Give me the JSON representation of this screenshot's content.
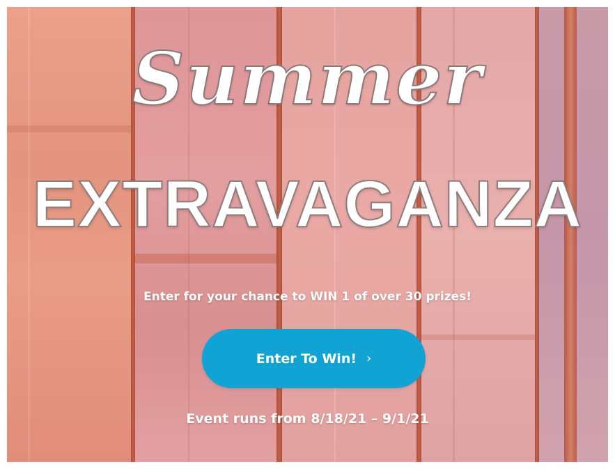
{
  "hero": {
    "script_title": "Summer",
    "main_title": "EXTRAVAGANZA",
    "tagline": "Enter for your chance to WIN 1 of over 30 prizes!",
    "cta": {
      "label": "Enter To Win!",
      "icon": "chevron-right-icon",
      "glyph": "›",
      "color": "#11a3d3"
    },
    "dates": "Event runs from 8/18/21 – 9/1/21"
  },
  "colors": {
    "text": "#ffffff",
    "button": "#11a3d3",
    "background": "#e39a8a"
  }
}
